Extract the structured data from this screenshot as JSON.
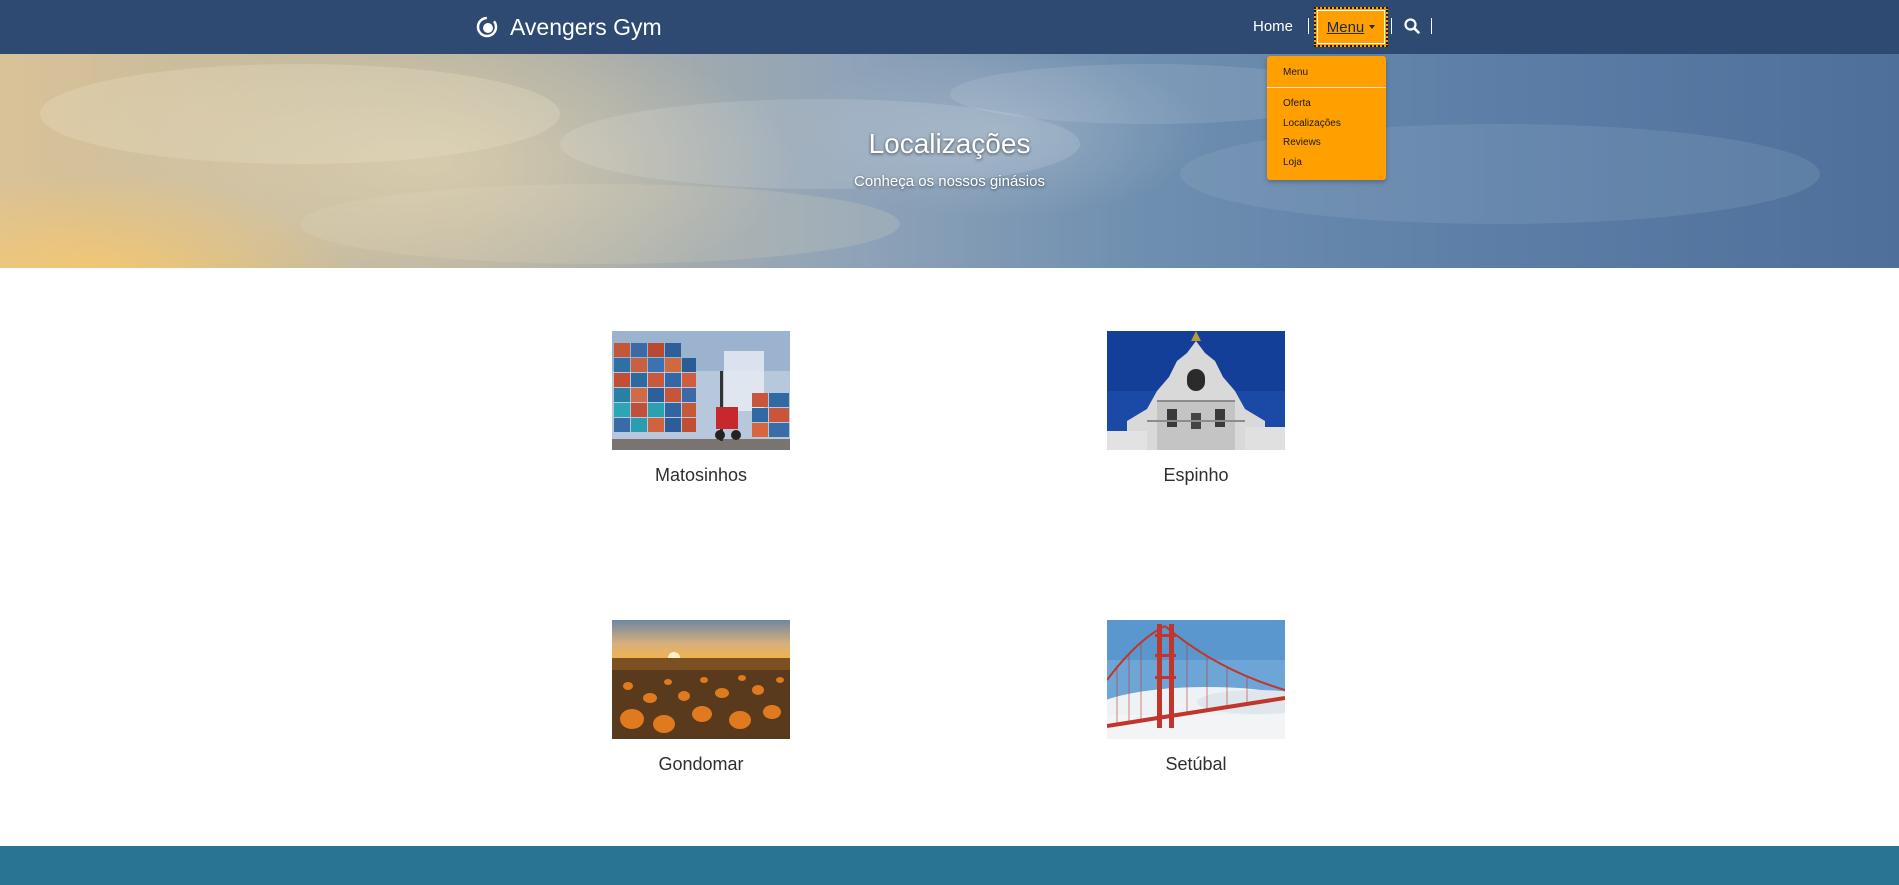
{
  "brand": {
    "name": "Avengers Gym"
  },
  "nav": {
    "home_label": "Home",
    "menu_label": "Menu",
    "search_icon": "search-icon"
  },
  "dropdown": {
    "header": "Menu",
    "items": [
      {
        "label": "Oferta"
      },
      {
        "label": "Localizações"
      },
      {
        "label": "Reviews"
      },
      {
        "label": "Loja"
      }
    ]
  },
  "hero": {
    "title": "Localizações",
    "subtitle": "Conheça os nossos ginásios"
  },
  "locations": [
    {
      "name": "Matosinhos",
      "image": "shipping-containers-photo"
    },
    {
      "name": "Espinho",
      "image": "baroque-church-tower-photo"
    },
    {
      "name": "Gondomar",
      "image": "pumpkin-field-sunset-photo"
    },
    {
      "name": "Setúbal",
      "image": "golden-gate-bridge-fog-photo"
    }
  ],
  "colors": {
    "navbar": "#2e4a72",
    "accent": "#ff9f00",
    "footer": "#277493"
  }
}
